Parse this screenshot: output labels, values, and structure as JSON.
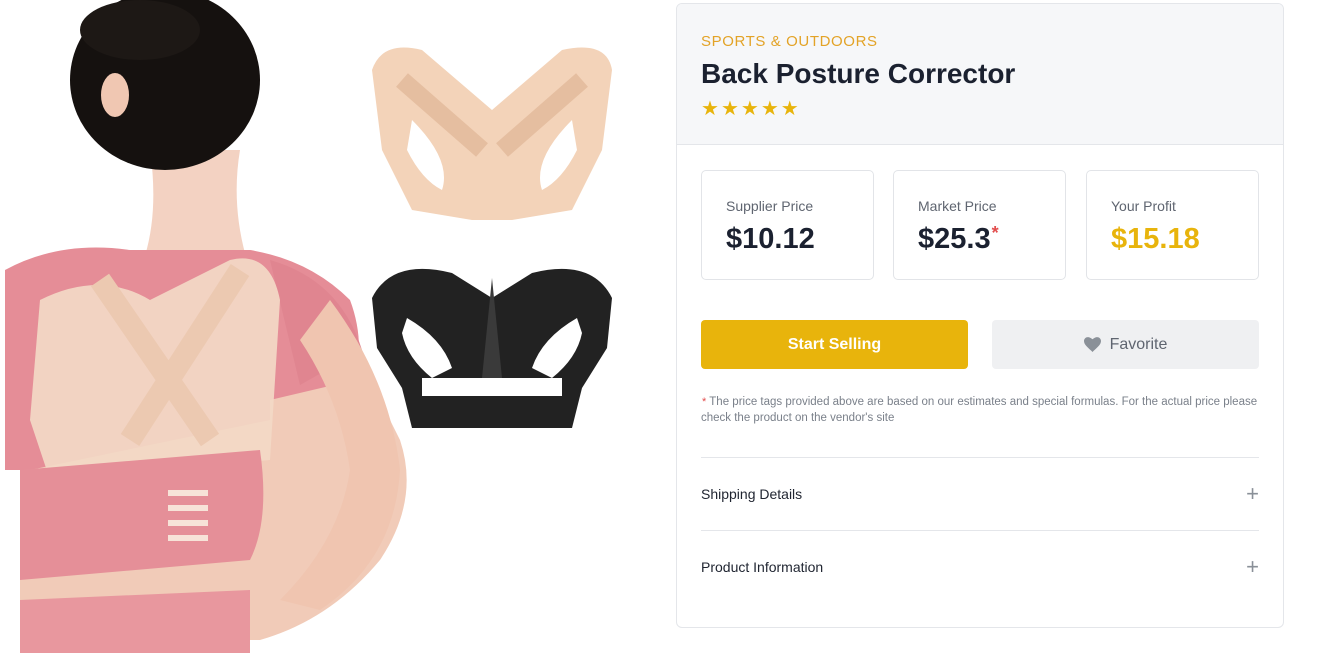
{
  "product": {
    "category": "SPORTS & OUTDOORS",
    "title": "Back Posture Corrector",
    "rating_stars": 5,
    "star_glyph": "★"
  },
  "prices": {
    "supplier": {
      "label": "Supplier Price",
      "value": "$10.12"
    },
    "market": {
      "label": "Market Price",
      "value": "$25.3",
      "marker": "*"
    },
    "profit": {
      "label": "Your Profit",
      "value": "$15.18"
    }
  },
  "actions": {
    "start_selling": "Start Selling",
    "favorite": "Favorite",
    "favorite_icon": "heart-icon"
  },
  "note": {
    "marker": "*",
    "text": "The price tags provided above are based on our estimates and special formulas. For the actual price please check the product on the vendor's site"
  },
  "accordion": [
    {
      "label": "Shipping Details",
      "icon": "plus-icon",
      "glyph": "+"
    },
    {
      "label": "Product Information",
      "icon": "plus-icon",
      "glyph": "+"
    }
  ],
  "colors": {
    "accent": "#e8b40c",
    "category": "#e3a327",
    "asterisk": "#e24c4c"
  }
}
